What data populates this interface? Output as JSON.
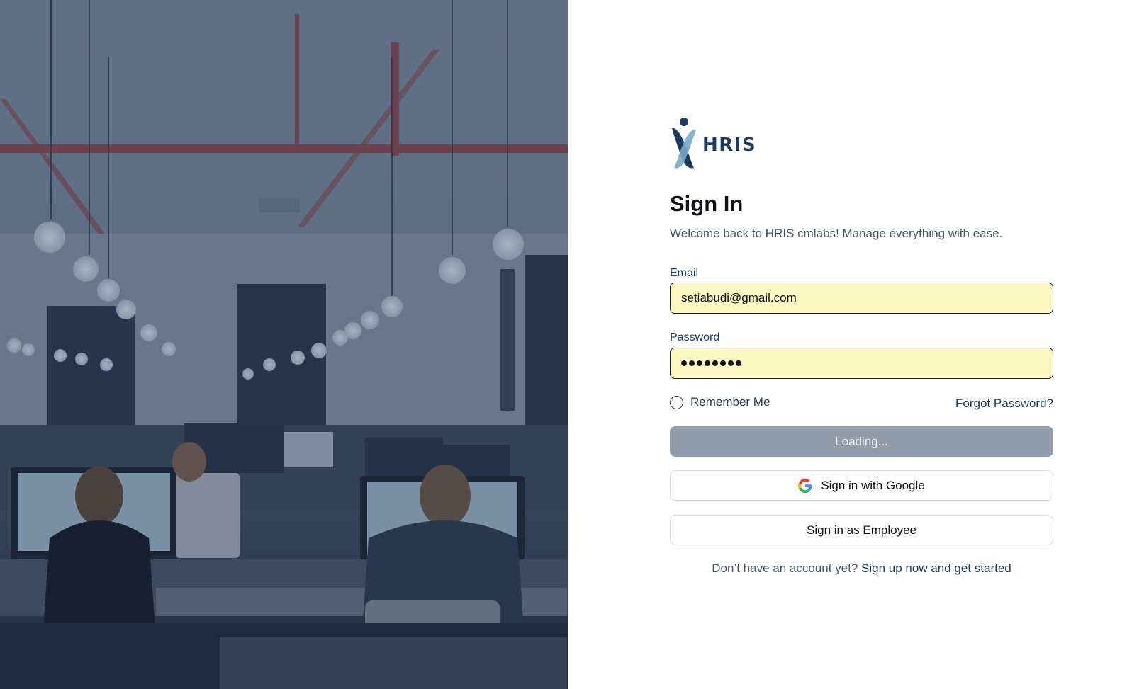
{
  "brand": {
    "logo_text": "HRIS",
    "colors": {
      "dark": "#1d3a5c",
      "light": "#7aa7c7"
    }
  },
  "signin": {
    "title": "Sign In",
    "subtitle": "Welcome back to HRIS cmlabs! Manage everything with ease."
  },
  "email": {
    "label": "Email",
    "value": "setiabudi@gmail.com"
  },
  "password": {
    "label": "Password",
    "masked_length": 8
  },
  "remember": {
    "label": "Remember Me",
    "checked": false
  },
  "forgot_label": "Forgot Password?",
  "buttons": {
    "primary_label": "Loading...",
    "google_label": "Sign in with Google",
    "employee_label": "Sign in as Employee"
  },
  "signup": {
    "prompt": "Don’t have an account yet?",
    "link": "Sign up now and get started"
  },
  "colors": {
    "input_bg": "#fdf9c4",
    "loading_btn": "#929dab",
    "link": "#1e3a5f"
  },
  "background_image": {
    "icon": "office-photo"
  }
}
